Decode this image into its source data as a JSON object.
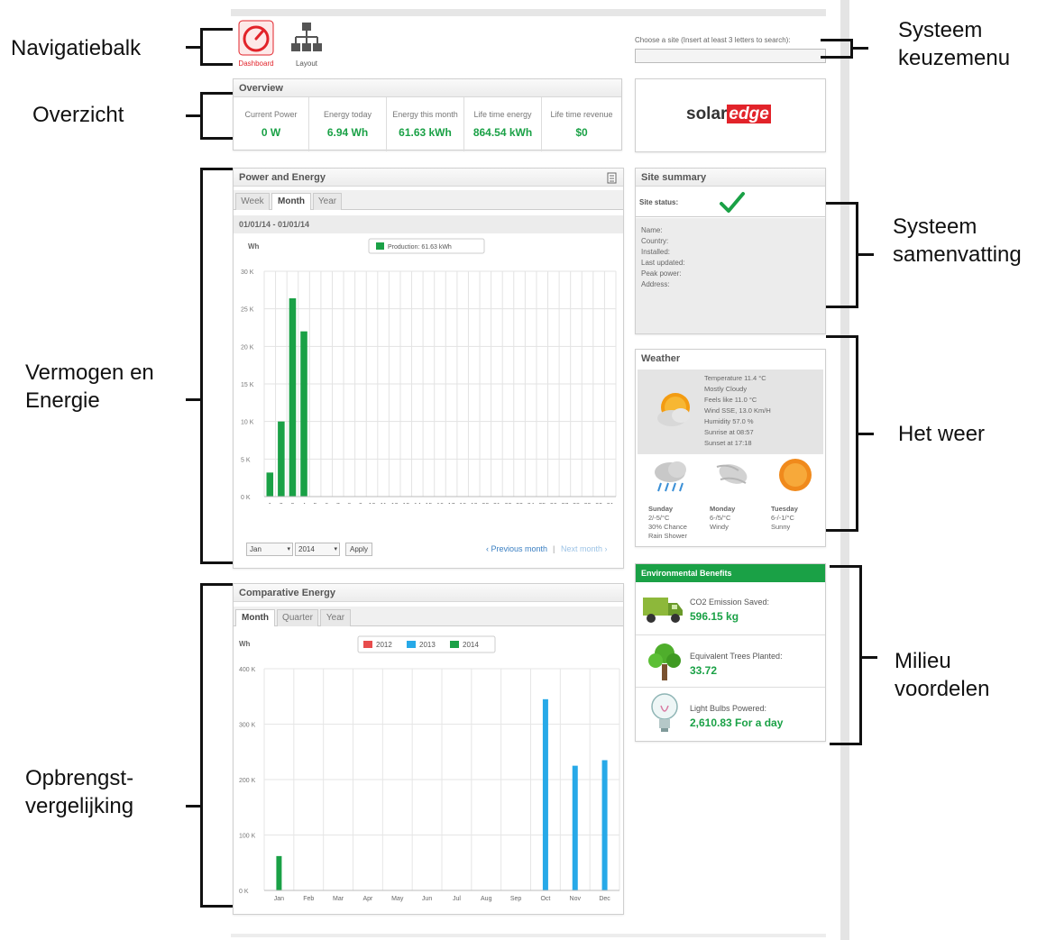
{
  "nav": {
    "items": [
      {
        "label": "Dashboard",
        "icon": "dashboard-gauge-icon",
        "active": true
      },
      {
        "label": "Layout",
        "icon": "layout-tree-icon",
        "active": false
      }
    ]
  },
  "site_chooser": {
    "label": "Choose a site (Insert at least 3 letters to search):",
    "value": ""
  },
  "overview": {
    "title": "Overview",
    "cells": [
      {
        "label": "Current Power",
        "value": "0 W"
      },
      {
        "label": "Energy today",
        "value": "6.94 Wh"
      },
      {
        "label": "Energy this month",
        "value": "61.63 kWh"
      },
      {
        "label": "Life time energy",
        "value": "864.54 kWh"
      },
      {
        "label": "Life time revenue",
        "value": "$0"
      }
    ]
  },
  "brand": {
    "text_left": "solar",
    "text_right": "edge",
    "color_dark": "#333333",
    "color_red": "#e2232a"
  },
  "power_energy": {
    "title": "Power and Energy",
    "tabs": [
      "Week",
      "Month",
      "Year"
    ],
    "active_tab": "Month",
    "date_range": "01/01/14 - 01/01/14",
    "unit": "Wh",
    "legend": "Production: 61.63 kWh",
    "controls": {
      "month": "Jan",
      "year": "2014",
      "apply": "Apply",
      "prev": "‹ Previous month",
      "sep": "|",
      "next": "Next month ›"
    }
  },
  "comparative": {
    "title": "Comparative Energy",
    "tabs": [
      "Month",
      "Quarter",
      "Year"
    ],
    "active_tab": "Month",
    "unit": "Wh"
  },
  "site_summary": {
    "title": "Site summary",
    "status_label": "Site status:",
    "fields": [
      "Name:",
      "Country:",
      "Installed:",
      "Last updated:",
      "Peak power:",
      "Address:"
    ]
  },
  "weather": {
    "title": "Weather",
    "current": [
      "Temperature 11.4 °C",
      "Mostly Cloudy",
      "Feels like 11.0 °C",
      "Wind SSE, 13.0 Km/H",
      "Humidity 57.0 %",
      "Sunrise at 08:57",
      "Sunset at 17:18"
    ],
    "forecast": [
      {
        "day": "Sunday",
        "temp": "2/-5/°C",
        "lines": [
          "30% Chance",
          "Rain Shower"
        ],
        "icon": "rain-cloud-icon"
      },
      {
        "day": "Monday",
        "temp": "6-/5/°C",
        "lines": [
          "Windy"
        ],
        "icon": "wind-cloud-icon"
      },
      {
        "day": "Tuesday",
        "temp": "6-/-1/°C",
        "lines": [
          "Sunny"
        ],
        "icon": "sun-icon"
      }
    ]
  },
  "env": {
    "title": "Environmental Benefits",
    "rows": [
      {
        "label": "CO2 Emission Saved:",
        "value": "596.15 kg",
        "icon": "truck-icon"
      },
      {
        "label": "Equivalent Trees Planted:",
        "value": "33.72",
        "icon": "tree-icon"
      },
      {
        "label": "Light Bulbs Powered:",
        "value": "2,610.83 For a day",
        "icon": "light-bulb-icon"
      }
    ]
  },
  "annotations": {
    "nav": "Navigatiebalk",
    "overview": "Overzicht",
    "power_line1": "Vermogen en",
    "power_line2": "Energie",
    "compare_line1": "Opbrengst-",
    "compare_line2": "vergelijking",
    "menu_line1": "Systeem",
    "menu_line2": "keuzemenu",
    "summary_line1": "Systeem",
    "summary_line2": "samenvatting",
    "weather": "Het weer",
    "env_line1": "Milieu",
    "env_line2": "voordelen"
  },
  "chart_data": [
    {
      "type": "bar",
      "title": "",
      "ylabel": "Wh",
      "ylim": [
        0,
        30000
      ],
      "y_ticks": [
        "0 K",
        "5 K",
        "10 K",
        "15 K",
        "20 K",
        "25 K",
        "30 K"
      ],
      "categories": [
        "1",
        "2",
        "3",
        "4",
        "5",
        "6",
        "7",
        "8",
        "9",
        "10",
        "11",
        "12",
        "13",
        "14",
        "15",
        "16",
        "17",
        "18",
        "19",
        "20",
        "21",
        "22",
        "23",
        "24",
        "25",
        "26",
        "27",
        "28",
        "29",
        "30",
        "31"
      ],
      "series": [
        {
          "name": "Production: 61.63 kWh",
          "color": "#1aa146",
          "values": [
            3200,
            10000,
            26400,
            22000,
            0,
            0,
            0,
            0,
            0,
            0,
            0,
            0,
            0,
            0,
            0,
            0,
            0,
            0,
            0,
            0,
            0,
            0,
            0,
            0,
            0,
            0,
            0,
            0,
            0,
            0,
            0
          ]
        }
      ],
      "grid": true,
      "legend": "top"
    },
    {
      "type": "bar",
      "title": "",
      "ylabel": "Wh",
      "ylim": [
        0,
        400000
      ],
      "y_ticks": [
        "0 K",
        "100 K",
        "200 K",
        "300 K",
        "400 K"
      ],
      "categories": [
        "Jan",
        "Feb",
        "Mar",
        "Apr",
        "May",
        "Jun",
        "Jul",
        "Aug",
        "Sep",
        "Oct",
        "Nov",
        "Dec"
      ],
      "series": [
        {
          "name": "2012",
          "color": "#e84c4c",
          "values": [
            0,
            0,
            0,
            0,
            0,
            0,
            0,
            0,
            0,
            0,
            0,
            0
          ]
        },
        {
          "name": "2013",
          "color": "#27a9e8",
          "values": [
            0,
            0,
            0,
            0,
            0,
            0,
            0,
            0,
            0,
            345000,
            225000,
            235000
          ]
        },
        {
          "name": "2014",
          "color": "#1aa146",
          "values": [
            62000,
            0,
            0,
            0,
            0,
            0,
            0,
            0,
            0,
            0,
            0,
            0
          ]
        }
      ],
      "grid": true,
      "legend": "top"
    }
  ]
}
